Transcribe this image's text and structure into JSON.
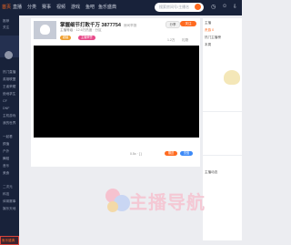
{
  "nav": {
    "items": [
      "首页",
      "直播",
      "分类",
      "赛事",
      "视频",
      "游戏",
      "鱼吧",
      "鱼乐盛典"
    ],
    "search_placeholder": "搜索房间号/主播名"
  },
  "sidebar": {
    "items": [
      "推荐",
      "关注",
      "热门直播",
      "英雄联盟",
      "王者荣耀",
      "绝地求生",
      "CF",
      "DNF",
      "主机游戏",
      "我的世界",
      "一起看",
      "颜值",
      "户外",
      "舞蹈",
      "音乐",
      "美食",
      "二次元",
      "科技",
      "体育赛事",
      "娱乐天地",
      "鱼乐盛典"
    ]
  },
  "room": {
    "title": "掌握细节打败千万 3877754",
    "title_small": "房间举报",
    "sub": "主播等级 · 12.6万热度 · 分区",
    "chip1": "超级",
    "chip2": "主播荣誉",
    "follow": "关注",
    "share": "分享",
    "meta_views": "1.2万",
    "meta_gift": "礼物",
    "video_controls": "0.5x  ·  [ ]",
    "btn1": "赠送",
    "btn2": "充值"
  },
  "right_panel": {
    "lines": [
      "主播",
      "贵族 0",
      "热门主播榜",
      "本周"
    ],
    "bottom": "主播动态"
  },
  "watermark": {
    "text": "主播导航"
  }
}
